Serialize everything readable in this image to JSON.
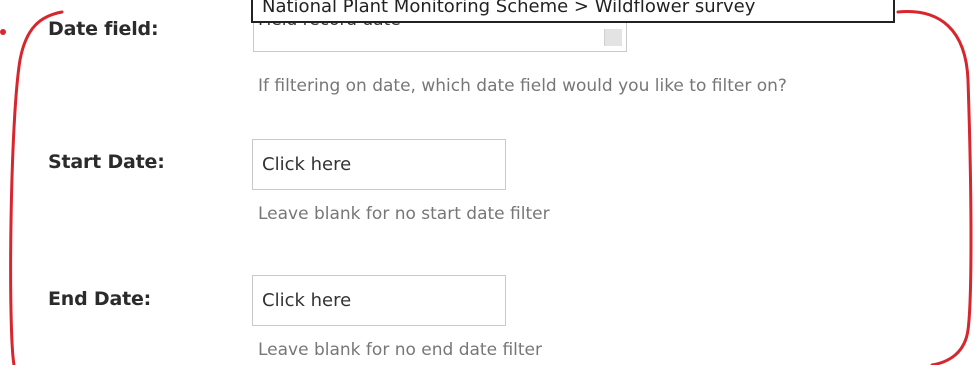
{
  "tooltip": {
    "text": "National Plant Monitoring Scheme > Wildflower survey"
  },
  "date_field": {
    "label": "Date field:",
    "value": "Field record date",
    "help": "If filtering on date, which date field would you like to filter on?"
  },
  "start_date": {
    "label": "Start Date:",
    "placeholder": "Click here",
    "help": "Leave blank for no start date filter"
  },
  "end_date": {
    "label": "End Date:",
    "placeholder": "Click here",
    "help": "Leave blank for no end date filter"
  },
  "colors": {
    "highlight": "#d7262e",
    "label": "#2b2b2b",
    "help_text": "#777777",
    "input_border": "#c9c9c9"
  }
}
